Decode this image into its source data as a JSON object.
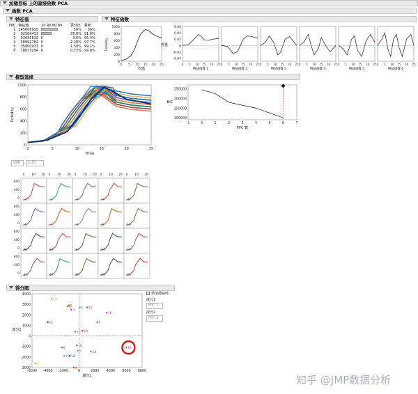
{
  "title_bar": "加载目标 上的直接函数 PCA",
  "sub_bar": "函数 PCA",
  "sections": {
    "eigenvalues": "特征值",
    "eigenfunctions": "特征函数",
    "model_select": "模型选择",
    "score_plot": "得分图"
  },
  "eig_table": {
    "headers": [
      "FPC",
      "特征值",
      "20 40 60 80",
      "百分比",
      "累积"
    ],
    "rows": [
      {
        "n": "1",
        "val": "145006915",
        "pct": "56%",
        "cum": "56%",
        "frac": 0.56
      },
      {
        "n": "2",
        "val": "92584433",
        "pct": "35.8%",
        "cum": "91.8%",
        "frac": 0.358
      },
      {
        "n": "3",
        "val": "93055632",
        "pct": "3.6%",
        "cum": "95.4%",
        "frac": 0.036
      },
      {
        "n": "4",
        "val": "58992782",
        "pct": "2.28%",
        "cum": "97.7%",
        "frac": 0.0228
      },
      {
        "n": "5",
        "val": "35800933",
        "pct": "1.38%",
        "cum": "99.1%",
        "frac": 0.0138
      },
      {
        "n": "6",
        "val": "18673294",
        "pct": "0.72%",
        "cum": "99.8%",
        "frac": 0.0072
      }
    ]
  },
  "mean_plot": {
    "ylabel": "Turbidity",
    "xlabel": "均值",
    "yticks": [
      "1000",
      "800",
      "600",
      "400",
      "200",
      "0"
    ],
    "xticks": [
      "0",
      "5",
      "10",
      "15",
      "20",
      "25"
    ],
    "curve": [
      [
        0,
        20
      ],
      [
        3,
        60
      ],
      [
        6,
        160
      ],
      [
        8,
        320
      ],
      [
        10,
        560
      ],
      [
        12,
        780
      ],
      [
        14,
        880
      ],
      [
        15,
        910
      ],
      [
        17,
        880
      ],
      [
        19,
        800
      ],
      [
        21,
        740
      ],
      [
        23,
        700
      ],
      [
        25,
        680
      ]
    ]
  },
  "eigfun_plot": {
    "ylabel": "权重",
    "yticks": [
      "0.06",
      "0.04",
      "0.02",
      "0",
      "-0.02",
      "-0.04"
    ],
    "xticks": [
      "0",
      "5",
      "10",
      "15",
      "20",
      "25"
    ],
    "panels": [
      {
        "label": "特征函数 1",
        "curve": [
          [
            0,
            0.0
          ],
          [
            4,
            0.002
          ],
          [
            8,
            0.02
          ],
          [
            11,
            0.035
          ],
          [
            13,
            0.028
          ],
          [
            15,
            0.018
          ],
          [
            18,
            0.016
          ],
          [
            21,
            0.02
          ],
          [
            25,
            0.022
          ]
        ]
      },
      {
        "label": "特征函数 2",
        "curve": [
          [
            0,
            0.0
          ],
          [
            4,
            -0.003
          ],
          [
            8,
            -0.025
          ],
          [
            11,
            -0.02
          ],
          [
            13,
            0.0
          ],
          [
            15,
            0.02
          ],
          [
            18,
            0.03
          ],
          [
            21,
            0.028
          ],
          [
            25,
            0.022
          ]
        ]
      },
      {
        "label": "特征函数 3",
        "curve": [
          [
            0,
            0.0
          ],
          [
            3,
            0.008
          ],
          [
            6,
            0.03
          ],
          [
            9,
            0.01
          ],
          [
            12,
            -0.03
          ],
          [
            14,
            -0.02
          ],
          [
            17,
            0.02
          ],
          [
            20,
            0.028
          ],
          [
            25,
            0.0
          ]
        ]
      },
      {
        "label": "特征函数 4",
        "curve": [
          [
            0,
            0.0
          ],
          [
            3,
            0.01
          ],
          [
            6,
            0.035
          ],
          [
            8,
            0.0
          ],
          [
            10,
            -0.03
          ],
          [
            13,
            -0.01
          ],
          [
            15,
            0.025
          ],
          [
            18,
            0.0
          ],
          [
            21,
            -0.02
          ],
          [
            25,
            0.0
          ]
        ]
      },
      {
        "label": "特征函数 5",
        "curve": [
          [
            0,
            0.0
          ],
          [
            3,
            -0.01
          ],
          [
            6,
            -0.03
          ],
          [
            9,
            0.02
          ],
          [
            11,
            0.03
          ],
          [
            13,
            -0.015
          ],
          [
            16,
            -0.035
          ],
          [
            19,
            0.015
          ],
          [
            22,
            0.035
          ],
          [
            25,
            0.01
          ]
        ]
      },
      {
        "label": "特征函数 6",
        "curve": [
          [
            0,
            0.0
          ],
          [
            3,
            0.02
          ],
          [
            5,
            0.04
          ],
          [
            7,
            -0.01
          ],
          [
            9,
            -0.035
          ],
          [
            11,
            0.02
          ],
          [
            13,
            0.035
          ],
          [
            15,
            -0.01
          ],
          [
            17,
            -0.035
          ],
          [
            20,
            0.02
          ],
          [
            23,
            0.035
          ],
          [
            25,
            0.0
          ]
        ]
      }
    ]
  },
  "fit_plot": {
    "ylabel": "Turbidity",
    "xlabel": "Time",
    "yticks": [
      "1000",
      "800",
      "600",
      "400",
      "200",
      "0"
    ],
    "xticks": [
      "0",
      "5",
      "10",
      "15",
      "20",
      "25"
    ],
    "colors": [
      "#e4572e",
      "#76b041",
      "#2e86ab",
      "#f6ae2d",
      "#8e44ad",
      "#1abc9c",
      "#c0392b",
      "#d35400",
      "#16a085",
      "#2c3e50",
      "#e84393",
      "#6c5ce7",
      "#00b894",
      "#fdcb6e",
      "#0984e3",
      "#b33939",
      "#218c74",
      "#cc8e35",
      "#706fd3",
      "#227093"
    ]
  },
  "bic_plot": {
    "ylabel": "BIC",
    "xlabel": "FPC 数",
    "yticks": [
      "250000",
      "200000",
      "150000",
      "100000"
    ],
    "xticks": [
      "-1",
      "0",
      "1",
      "2",
      "3",
      "4",
      "5",
      "6",
      "7"
    ],
    "points": [
      [
        0,
        245000
      ],
      [
        1,
        225000
      ],
      [
        2,
        180000
      ],
      [
        3,
        165000
      ],
      [
        4,
        150000
      ],
      [
        5,
        125000
      ],
      [
        6,
        100000
      ]
    ],
    "selected": 6,
    "selected_y": 265000
  },
  "controls": {
    "zoom_label": "切换",
    "range_label": "1-20",
    "checkbox_label": "添加按曲线",
    "comp1": "成分1",
    "comp1_val": "FPC 1",
    "comp2": "成分2",
    "comp2_val": "FPC 2"
  },
  "grid": {
    "xticks": [
      "0",
      "10",
      "20"
    ],
    "yticks": [
      "800",
      "400",
      "0"
    ],
    "colors": [
      "#c0392b",
      "#27ae60",
      "#8e44ad",
      "#c0392b",
      "#556b2f",
      "#8e44ad",
      "#d35400",
      "#7f8c8d",
      "#d35400",
      "#8e6b2f",
      "#2c3e50",
      "#c0392b",
      "#556b2f",
      "#2c3e50",
      "#8e44ad",
      "#8e44ad",
      "#2c8c8c",
      "#8b5a2b",
      "#2c3e50",
      "#c0392b"
    ],
    "labels": [
      "1",
      "2",
      "3",
      "4",
      "5",
      "6",
      "7",
      "8",
      "9",
      "10",
      "11",
      "12",
      "13",
      "14",
      "15",
      "16",
      "17",
      "18",
      "19",
      "20"
    ]
  },
  "score_plot": {
    "xlabel": "成分1",
    "ylabel": "成分2",
    "xticks": [
      "-6000",
      "-4000",
      "-2000",
      "0",
      "2000",
      "4000",
      "6000",
      "8000"
    ],
    "yticks": [
      "4000",
      "3000",
      "2000",
      "1000",
      "0",
      "-1000",
      "-2000",
      "-3000"
    ],
    "points": [
      {
        "id": "1",
        "x": 2300,
        "y": 1300,
        "c": "#c0392b"
      },
      {
        "id": "2",
        "x": 100,
        "y": 2700,
        "c": "#27ae60"
      },
      {
        "id": "3",
        "x": -1000,
        "y": 2500,
        "c": "#8e44ad"
      },
      {
        "id": "4",
        "x": -1500,
        "y": 2800,
        "c": "#d35400"
      },
      {
        "id": "5",
        "x": -1300,
        "y": 2900,
        "c": "#556b2f"
      },
      {
        "id": "6",
        "x": -2200,
        "y": -1100,
        "c": "#8e44ad"
      },
      {
        "id": "7",
        "x": -5600,
        "y": -2600,
        "c": "#d4a017"
      },
      {
        "id": "8",
        "x": -200,
        "y": -1400,
        "c": "#7f8c8d"
      },
      {
        "id": "9",
        "x": -700,
        "y": -3000,
        "c": "#d35400"
      },
      {
        "id": "10",
        "x": -500,
        "y": 400,
        "c": "#8e6b2f"
      },
      {
        "id": "11",
        "x": -4000,
        "y": 1300,
        "c": "#2c3e50"
      },
      {
        "id": "12",
        "x": 1000,
        "y": 2700,
        "c": "#c0392b"
      },
      {
        "id": "13",
        "x": 1500,
        "y": -1500,
        "c": "#556b2f"
      },
      {
        "id": "14",
        "x": -1200,
        "y": -1900,
        "c": "#2c3e50"
      },
      {
        "id": "15",
        "x": 6000,
        "y": -1100,
        "c": "#8e44ad"
      },
      {
        "id": "16",
        "x": 3500,
        "y": 2200,
        "c": "#8e44ad"
      },
      {
        "id": "17",
        "x": -3500,
        "y": 3500,
        "c": "#e67e22"
      },
      {
        "id": "18",
        "x": -300,
        "y": -900,
        "c": "#8b5a2b"
      },
      {
        "id": "19",
        "x": -1900,
        "y": -1900,
        "c": "#2c8c8c"
      },
      {
        "id": "20",
        "x": 400,
        "y": 500,
        "c": "#c0392b"
      }
    ],
    "highlight": "15"
  },
  "watermark": "知乎 @JMP数据分析"
}
